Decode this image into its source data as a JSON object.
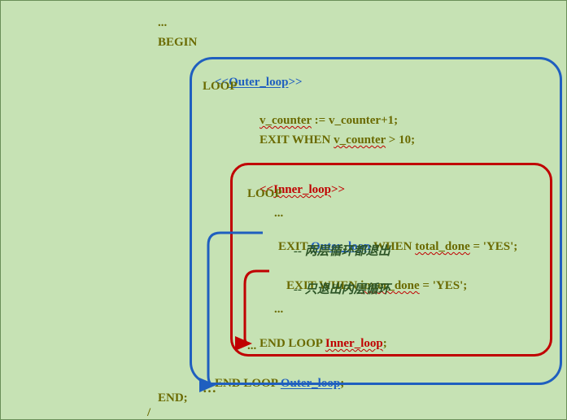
{
  "code": {
    "l0": "...",
    "l1": "BEGIN",
    "outer_label_open": "<<",
    "outer_label_name": "Outer_loop",
    "outer_label_close": ">>",
    "l3": "LOOP",
    "l4a": "v_counter",
    "l4b": " := ",
    "l4c": "v_counter+1;",
    "l5a": "EXIT WHEN ",
    "l5b": "v_counter",
    "l5c": " > 10;",
    "inner_label_open": "<<",
    "inner_label_name": "Inner_loop",
    "inner_label_close": ">>",
    "l7": "LOOP",
    "l8": "...",
    "l9a": "EXIT ",
    "l9b": "Outer_loop",
    "l9c": " WHEN ",
    "l9d": "total_done",
    "l9e": " = 'YES';",
    "comment1": "-- 两层循环都退出",
    "l11a": "EXIT WHEN ",
    "l11b": "inner_done",
    "l11c": " = 'YES';",
    "comment2": "-- 只退出内层循环",
    "l13": "...",
    "l14a": "END LOOP ",
    "l14b": "Inner_loop",
    "l14c": ";",
    "l15": "...",
    "l16a": "END LOOP ",
    "l16b": "Outer_loop",
    "l16c": ";",
    "l17": "…",
    "l18": "END;",
    "l19": "/"
  },
  "colors": {
    "bg": "#c6e2b4",
    "olive": "#6a6a00",
    "blue": "#1f5fbf",
    "red": "#c00000",
    "darkgreen": "#2d5527"
  }
}
